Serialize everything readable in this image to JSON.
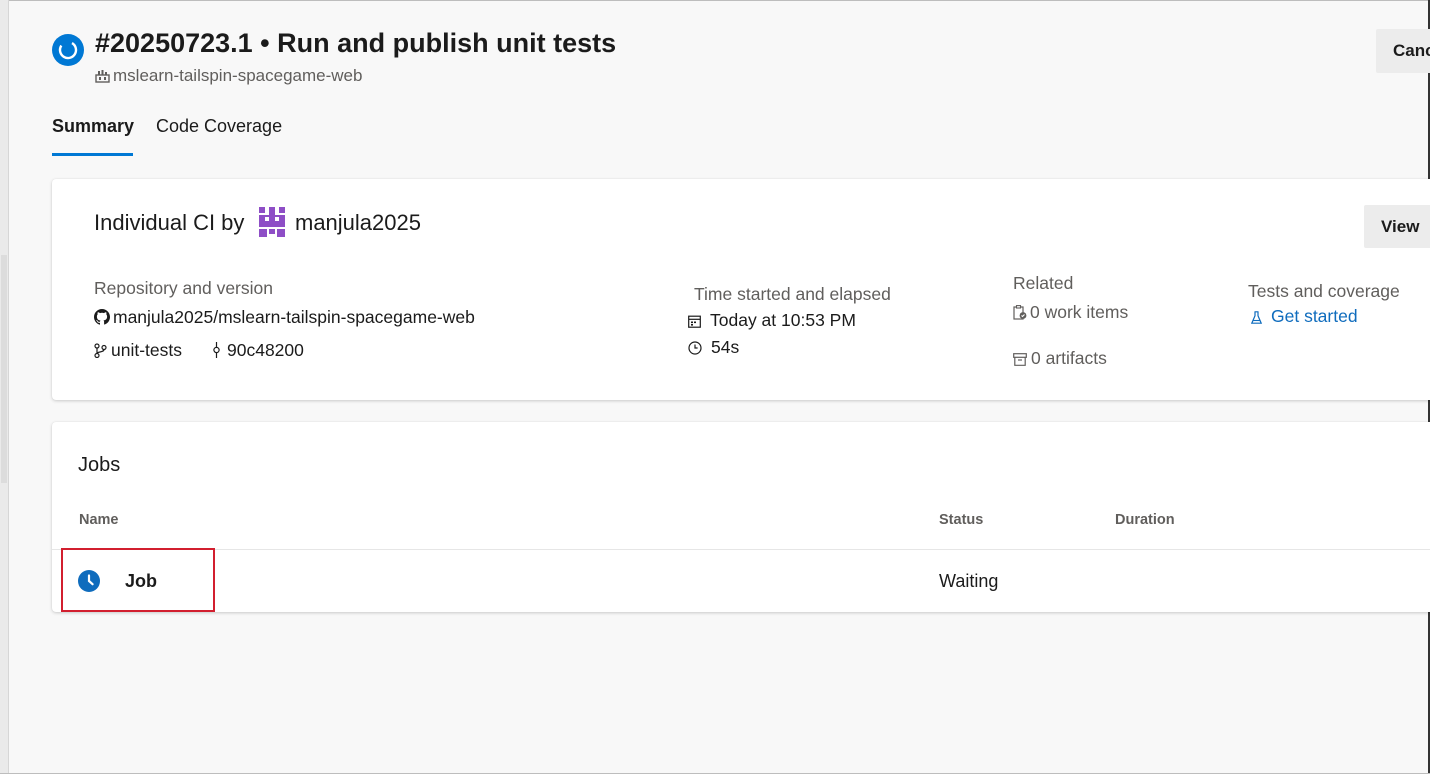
{
  "header": {
    "run_title": "#20250723.1 • Run and publish unit tests",
    "pipeline_name": "mslearn-tailspin-spacegame-web",
    "cancel_label": "Canc",
    "run_icon": "in-progress-icon",
    "pipeline_icon": "pipeline-icon"
  },
  "tabs": [
    {
      "label": "Summary",
      "active": true
    },
    {
      "label": "Code Coverage",
      "active": false
    }
  ],
  "summary": {
    "trigger_text": "Individual CI by",
    "user": "manjula2025",
    "view_label": "View",
    "repository": {
      "heading": "Repository and version",
      "repo": "manjula2025/mslearn-tailspin-spacegame-web",
      "branch": "unit-tests",
      "commit": "90c48200"
    },
    "time": {
      "heading": "Time started and elapsed",
      "started": "Today at 10:53 PM",
      "elapsed": "54s"
    },
    "related": {
      "heading": "Related",
      "work_items": "0 work items",
      "artifacts": "0 artifacts"
    },
    "tests": {
      "heading": "Tests and coverage",
      "link": "Get started"
    }
  },
  "jobs": {
    "title": "Jobs",
    "columns": [
      "Name",
      "Status",
      "Duration"
    ],
    "rows": [
      {
        "name": "Job",
        "status": "Waiting",
        "duration": "",
        "icon": "clock-icon"
      }
    ]
  },
  "colors": {
    "accent": "#0078d4",
    "link": "#0f6cbd",
    "highlight": "#d21f2f",
    "avatar": "#8e4ec6"
  }
}
